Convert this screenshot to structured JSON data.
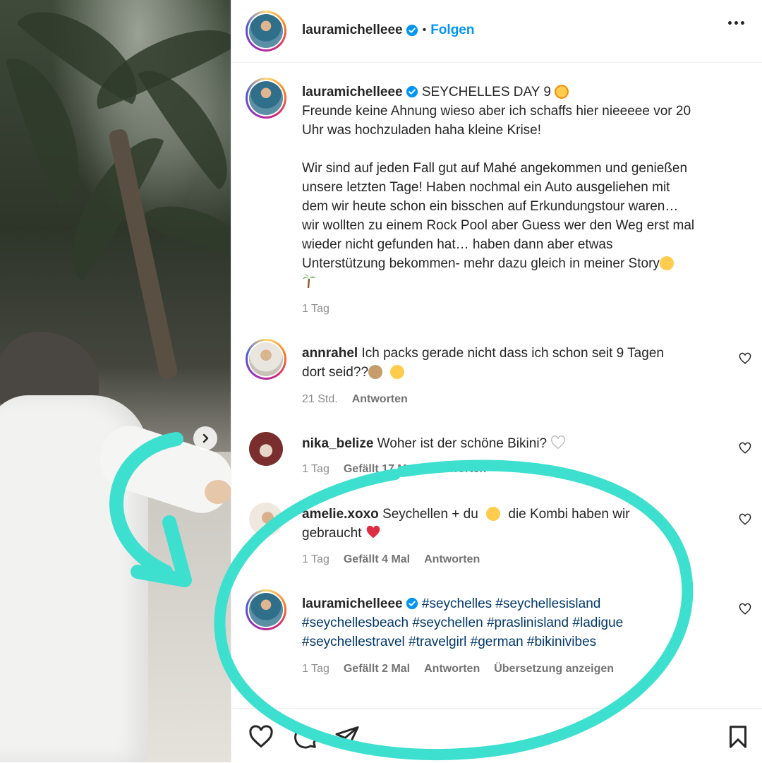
{
  "post": {
    "username": "lauramichelleee",
    "follow_label": "Folgen",
    "separator": "•",
    "caption_title": "SEYCHELLES DAY 9",
    "caption_lines": [
      "Freunde keine Ahnung wieso aber ich schaffs hier nieeeee vor 20",
      "Uhr was hochzuladen haha kleine Krise!",
      "",
      "Wir sind auf jeden Fall gut auf Mahé angekommen und genießen",
      "unsere letzten Tage! Haben nochmal ein Auto ausgeliehen mit",
      "dem wir heute schon ein bisschen auf Erkundungstour waren…",
      "wir wollten zu einem Rock Pool aber Guess wer den Weg erst mal",
      "wieder nicht gefunden hat… haben dann aber etwas",
      "Unterstützung bekommen- mehr dazu gleich in meiner Story"
    ],
    "caption_time": "1 Tag"
  },
  "comments": [
    {
      "username": "annrahel",
      "text_line1": "Ich packs gerade nicht dass ich schon seit 9 Tagen",
      "text_line2": "dort seid??",
      "time": "21 Std.",
      "reply": "Antworten"
    },
    {
      "username": "nika_belize",
      "text": "Woher ist der schöne Bikini?",
      "time": "1 Tag",
      "likes": "Gefällt 17 Mal",
      "reply": "Antworten"
    },
    {
      "username": "amelie.xoxo",
      "text_line1a": "Seychellen + du",
      "text_line1b": "die Kombi haben wir",
      "text_line2": "gebraucht",
      "time": "1 Tag",
      "likes": "Gefällt 4 Mal",
      "reply": "Antworten"
    },
    {
      "username": "lauramichelleee",
      "tags_line1": "#seychelles #seychellesisland",
      "tags_line2": "#seychellesbeach #seychellen #praslinisland #ladigue",
      "tags_line3": "#seychellestravel #travelgirl #german #bikinivibes",
      "time": "1 Tag",
      "likes": "Gefällt 2 Mal",
      "reply": "Antworten",
      "translate": "Übersetzung anzeigen"
    }
  ],
  "icons": {
    "verified": "verified-badge-icon",
    "more": "more-options-icon",
    "like": "heart-icon",
    "comment": "comment-icon",
    "share": "paper-plane-icon",
    "save": "bookmark-icon",
    "next": "chevron-right-icon"
  },
  "colors": {
    "accent": "#0095f6",
    "annotation": "#3de0cf",
    "hashtag": "#00376b"
  }
}
